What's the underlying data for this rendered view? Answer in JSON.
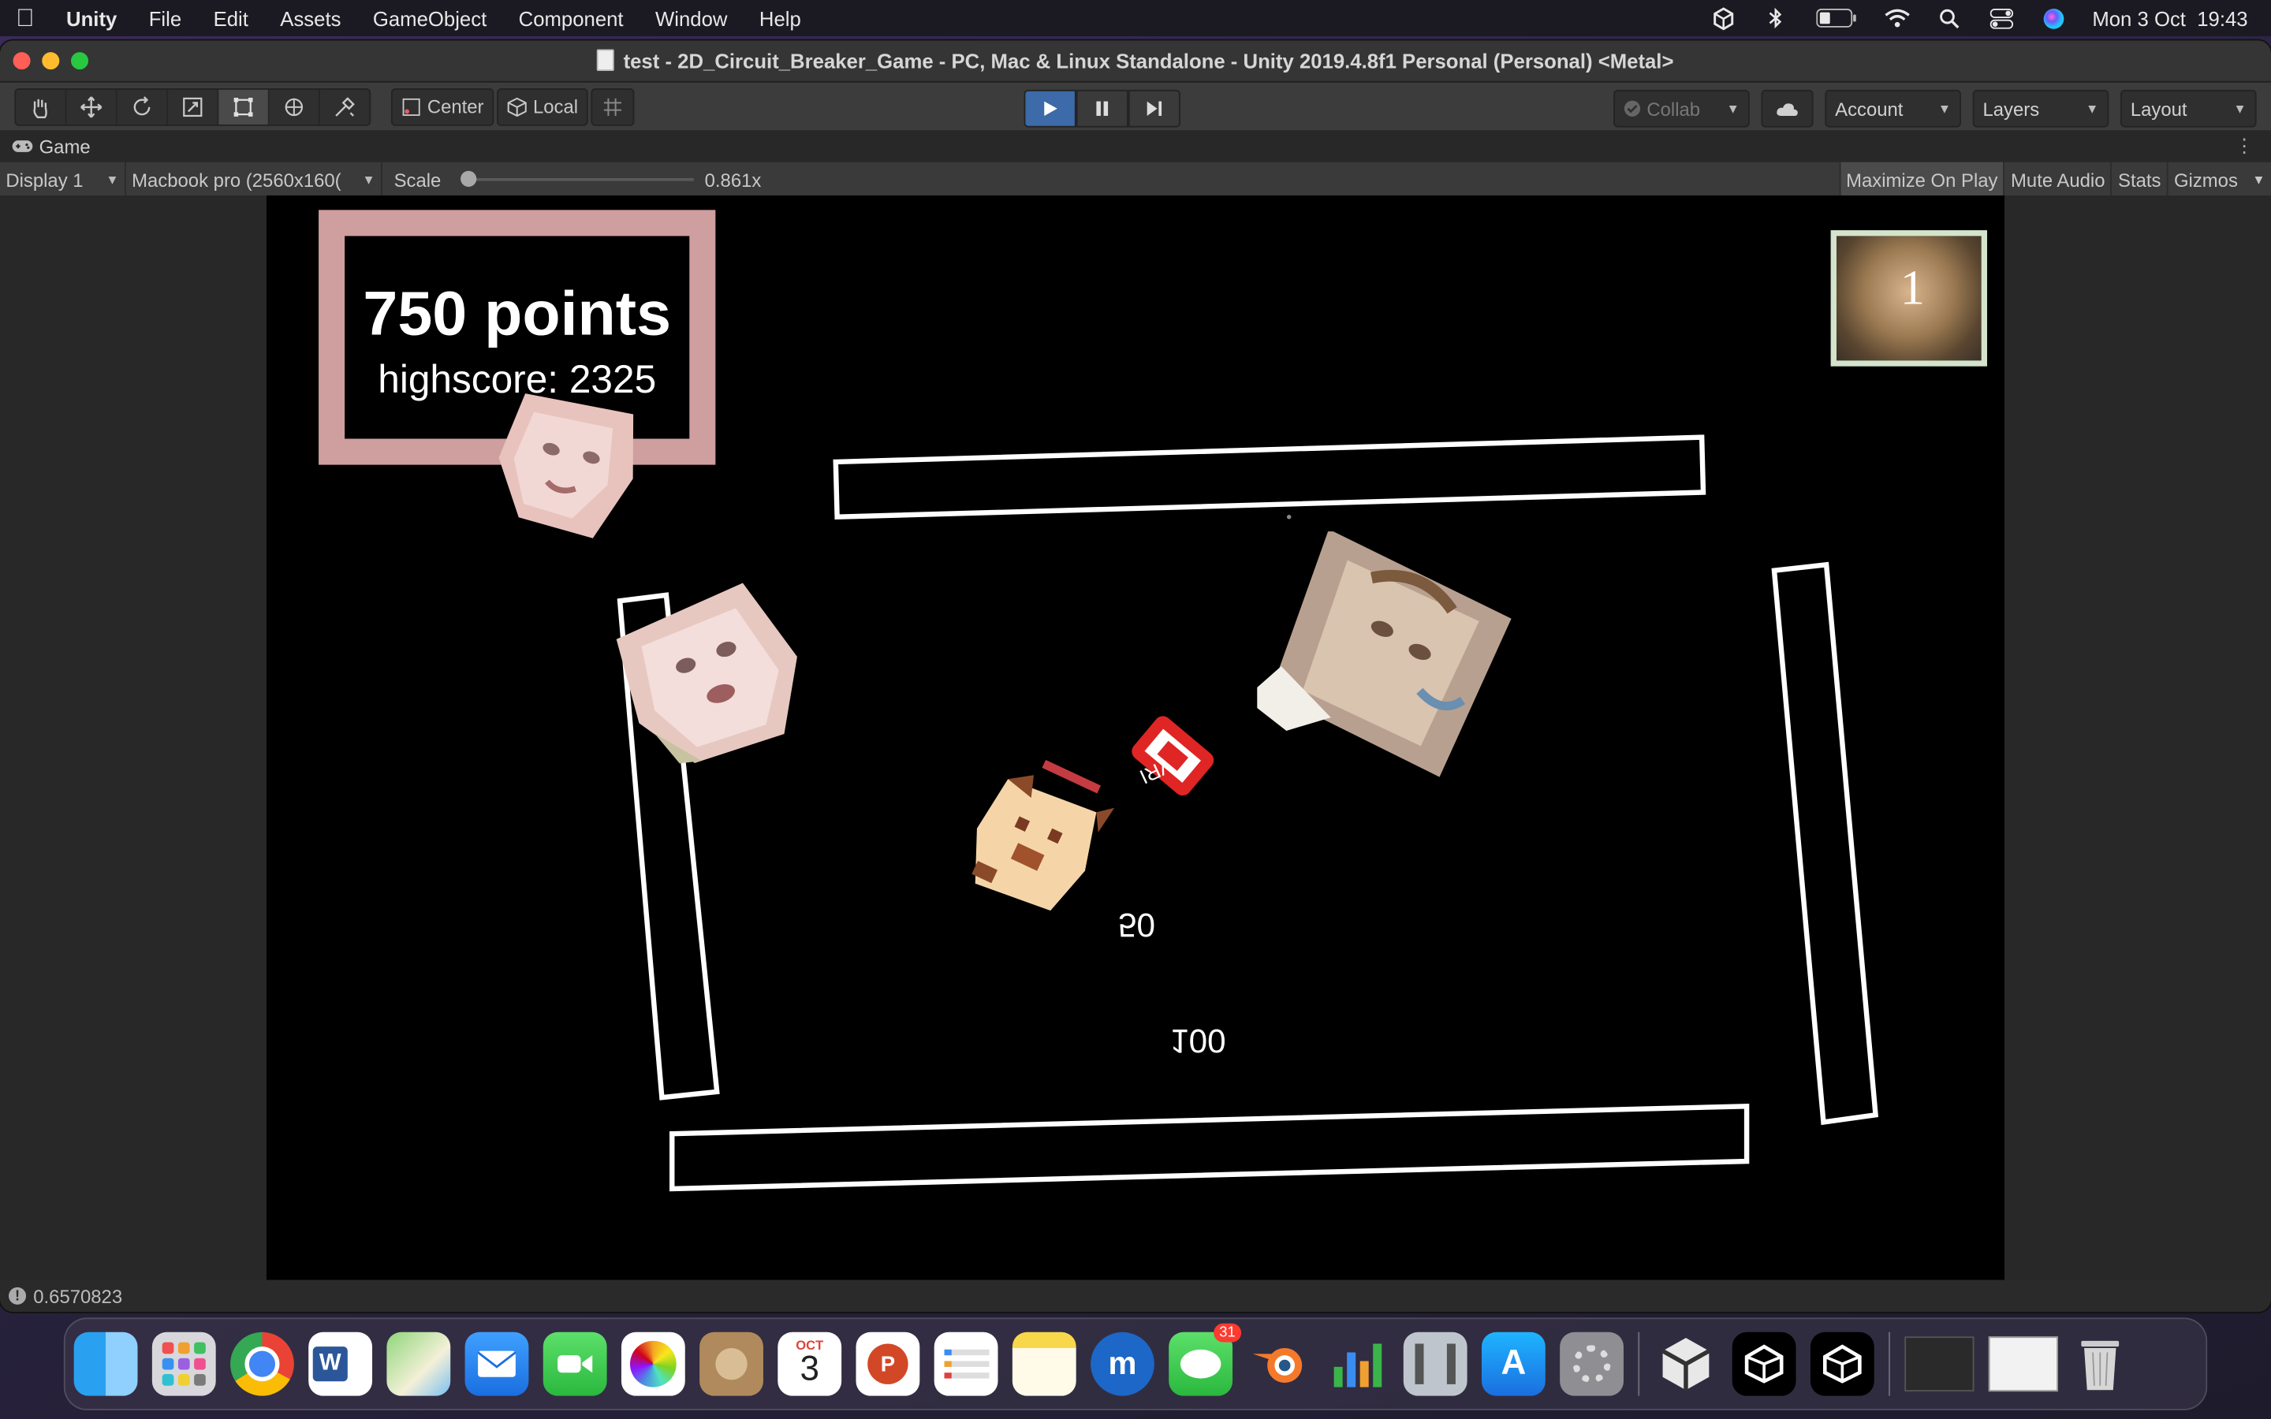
{
  "menubar": {
    "app_name": "Unity",
    "menus": [
      "File",
      "Edit",
      "Assets",
      "GameObject",
      "Component",
      "Window",
      "Help"
    ],
    "datetime": "Mon 3 Oct  19:43",
    "status_icons": [
      "unity-hub-icon",
      "bluetooth-icon",
      "battery-icon",
      "wifi-icon",
      "spotlight-search-icon",
      "control-center-icon",
      "siri-icon"
    ]
  },
  "window": {
    "title": "test - 2D_Circuit_Breaker_Game - PC, Mac & Linux Standalone - Unity 2019.4.8f1 Personal (Personal) <Metal>"
  },
  "toolbar": {
    "pivot_center": "Center",
    "pivot_local": "Local",
    "collab": "Collab",
    "account": "Account",
    "layers": "Layers",
    "layout": "Layout"
  },
  "game_tab": {
    "label": "Game",
    "display": "Display 1",
    "resolution": "Macbook pro (2560x160(",
    "scale_label": "Scale",
    "scale_value": "0.861x",
    "maximize": "Maximize On Play",
    "mute": "Mute Audio",
    "stats": "Stats",
    "gizmos": "Gizmos"
  },
  "game": {
    "points_text": "750 points",
    "highscore_text": "highscore: 2325",
    "minimap_number": "1",
    "floating_score_a": "50",
    "floating_score_b": "100",
    "player_label": "VRI"
  },
  "status": {
    "message": "0.6570823"
  },
  "dock": {
    "apps": [
      "finder-icon",
      "launchpad-icon",
      "chrome-icon",
      "word-icon",
      "maps-icon",
      "mail-icon",
      "facetime-icon",
      "photos-icon",
      "contacts-icon",
      "calendar-icon",
      "powerpoint-icon",
      "reminders-icon",
      "notes-icon",
      "musescore-icon",
      "messages-icon",
      "blender-icon",
      "numbers-icon",
      "pages-icon",
      "app-store-icon",
      "system-preferences-icon",
      "unity-hub-icon",
      "unity-icon",
      "unity-icon-2",
      "screenshot-thumb-1",
      "screenshot-thumb-2",
      "trash-icon"
    ],
    "calendar_month": "OCT",
    "calendar_day": "3",
    "messages_badge": "31"
  },
  "colors": {
    "score_border": "#cf9e9e",
    "minimap_border": "#d4e4cc",
    "play_active": "#3d6aa8"
  }
}
